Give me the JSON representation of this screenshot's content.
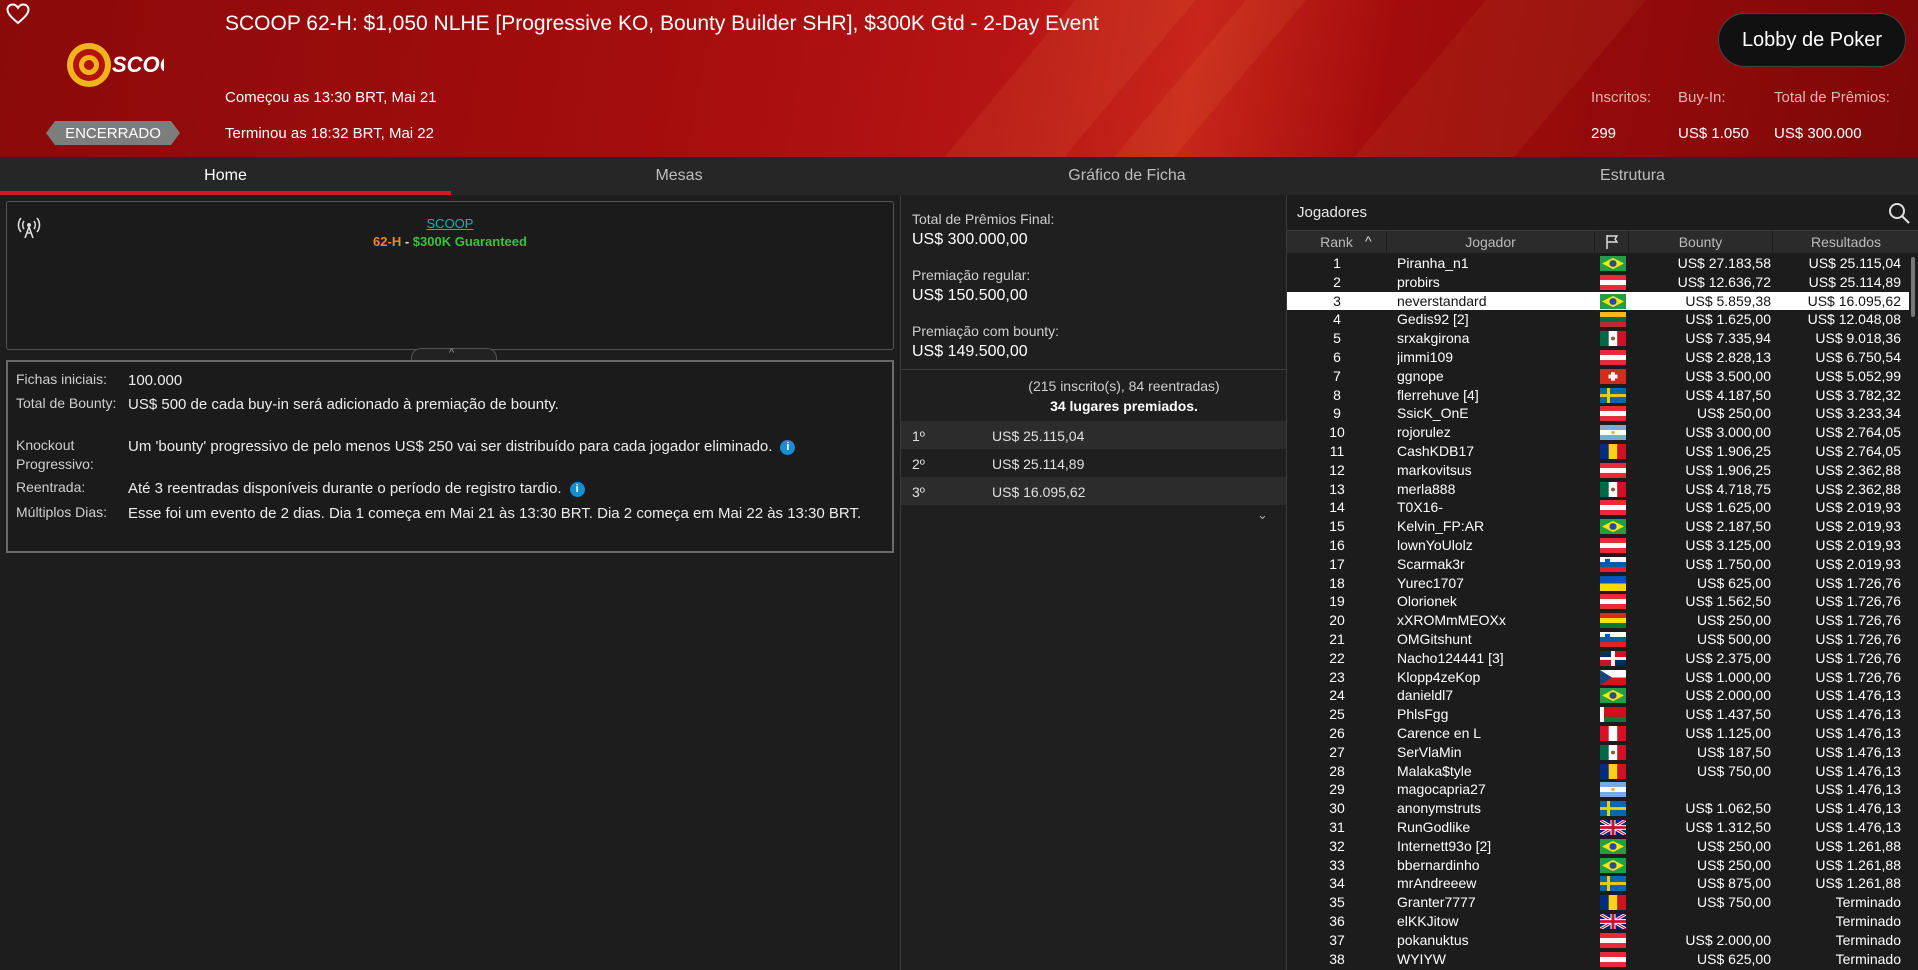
{
  "header": {
    "title": "SCOOP 62-H: $1,050 NLHE [Progressive KO, Bounty Builder SHR], $300K Gtd - 2-Day Event",
    "status_badge": "ENCERRADO",
    "started": "Começou as 13:30 BRT, Mai 21",
    "ended": "Terminou as 18:32 BRT, Mai 22",
    "lobby_button": "Lobby de Poker",
    "logo_text": "SCOOP",
    "stats": {
      "entrants_label": "Inscritos:",
      "entrants_value": "299",
      "buyin_label": "Buy-In:",
      "buyin_value": "US$ 1.050",
      "prize_label": "Total de Prêmios:",
      "prize_value": "US$ 300.000"
    }
  },
  "tabs": [
    {
      "label": "Home",
      "active": true
    },
    {
      "label": "Mesas"
    },
    {
      "label": "Gráfico de Ficha"
    },
    {
      "label": "Estrutura"
    }
  ],
  "info": {
    "link": "SCOOP",
    "sub_event": "62-H",
    "sub_sep": " - ",
    "sub_guarantee": "$300K Guaranteed"
  },
  "details": [
    {
      "label": "Fichas iniciais:",
      "value": "100.000"
    },
    {
      "label": "Total de Bounty:",
      "value": "US$ 500 de cada buy-in será adicionado à premiação de bounty."
    },
    {
      "label": "Knockout Progressivo:",
      "value": "Um 'bounty' progressivo de pelo menos US$ 250 vai ser distribuído para cada jogador eliminado."
    },
    {
      "label": "Reentrada:",
      "value": "Até 3 reentradas disponíveis durante o período de registro tardio."
    },
    {
      "label": "Múltiplos Dias:",
      "value": "Esse foi um evento de 2 dias. Dia 1 começa em Mai 21 às 13:30 BRT. Dia 2 começa em Mai 22 às 13:30 BRT."
    }
  ],
  "prizes": {
    "final_label": "Total de Prêmios Final:",
    "final_value": "US$ 300.000,00",
    "regular_label": "Premiação regular:",
    "regular_value": "US$ 150.500,00",
    "bounty_label": "Premiação com bounty:",
    "bounty_value": "US$ 149.500,00",
    "entries_text": "(215 inscrito(s), 84 reentradas)",
    "places_text": "34 lugares premiados.",
    "places": [
      {
        "place": "1º",
        "amount": "US$ 25.115,04"
      },
      {
        "place": "2º",
        "amount": "US$ 25.114,89"
      },
      {
        "place": "3º",
        "amount": "US$ 16.095,62"
      }
    ]
  },
  "players": {
    "title": "Jogadores",
    "columns": {
      "rank": "Rank",
      "player": "Jogador",
      "bounty": "Bounty",
      "results": "Resultados"
    },
    "highlight_rank": "3",
    "rows": [
      {
        "rank": "1",
        "name": "Piranha_n1",
        "flag": "br",
        "bounty": "US$ 27.183,58",
        "result": "US$ 25.115,04"
      },
      {
        "rank": "2",
        "name": "probirs",
        "flag": "at",
        "bounty": "US$ 12.636,72",
        "result": "US$ 25.114,89"
      },
      {
        "rank": "3",
        "name": "neverstandard",
        "flag": "br",
        "bounty": "US$ 5.859,38",
        "result": "US$ 16.095,62"
      },
      {
        "rank": "4",
        "name": "Gedis92 [2]",
        "flag": "lt",
        "bounty": "US$ 1.625,00",
        "result": "US$ 12.048,08"
      },
      {
        "rank": "5",
        "name": "srxakgirona",
        "flag": "mx",
        "bounty": "US$ 7.335,94",
        "result": "US$ 9.018,36"
      },
      {
        "rank": "6",
        "name": "jimmi109",
        "flag": "at",
        "bounty": "US$ 2.828,13",
        "result": "US$ 6.750,54"
      },
      {
        "rank": "7",
        "name": "ggnope",
        "flag": "ch",
        "bounty": "US$ 3.500,00",
        "result": "US$ 5.052,99"
      },
      {
        "rank": "8",
        "name": "flerrehuve [4]",
        "flag": "se",
        "bounty": "US$ 4.187,50",
        "result": "US$ 3.782,32"
      },
      {
        "rank": "9",
        "name": "SsicK_OnE",
        "flag": "at",
        "bounty": "US$ 250,00",
        "result": "US$ 3.233,34"
      },
      {
        "rank": "10",
        "name": "rojorulez",
        "flag": "ar",
        "bounty": "US$ 3.000,00",
        "result": "US$ 2.764,05"
      },
      {
        "rank": "11",
        "name": "CashKDB17",
        "flag": "ro",
        "bounty": "US$ 1.906,25",
        "result": "US$ 2.764,05"
      },
      {
        "rank": "12",
        "name": "markovitsus",
        "flag": "at",
        "bounty": "US$ 1.906,25",
        "result": "US$ 2.362,88"
      },
      {
        "rank": "13",
        "name": "merla888",
        "flag": "mx",
        "bounty": "US$ 4.718,75",
        "result": "US$ 2.362,88"
      },
      {
        "rank": "14",
        "name": "T0X16-",
        "flag": "at",
        "bounty": "US$ 1.625,00",
        "result": "US$ 2.019,93"
      },
      {
        "rank": "15",
        "name": "Kelvin_FP:AR",
        "flag": "br",
        "bounty": "US$ 2.187,50",
        "result": "US$ 2.019,93"
      },
      {
        "rank": "16",
        "name": "lownYoUlolz",
        "flag": "at",
        "bounty": "US$ 3.125,00",
        "result": "US$ 2.019,93"
      },
      {
        "rank": "17",
        "name": "Scarmak3r",
        "flag": "si",
        "bounty": "US$ 1.750,00",
        "result": "US$ 2.019,93"
      },
      {
        "rank": "18",
        "name": "Yurec1707",
        "flag": "ua",
        "bounty": "US$ 625,00",
        "result": "US$ 1.726,76"
      },
      {
        "rank": "19",
        "name": "Olorionek",
        "flag": "at",
        "bounty": "US$ 1.562,50",
        "result": "US$ 1.726,76"
      },
      {
        "rank": "20",
        "name": "xXROMmMEOXx",
        "flag": "bo",
        "bounty": "US$ 250,00",
        "result": "US$ 1.726,76"
      },
      {
        "rank": "21",
        "name": "OMGitshunt",
        "flag": "si",
        "bounty": "US$ 500,00",
        "result": "US$ 1.726,76"
      },
      {
        "rank": "22",
        "name": "Nacho124441 [3]",
        "flag": "do",
        "bounty": "US$ 2.375,00",
        "result": "US$ 1.726,76"
      },
      {
        "rank": "23",
        "name": "Klopp4zeKop",
        "flag": "cz",
        "bounty": "US$ 1.000,00",
        "result": "US$ 1.726,76"
      },
      {
        "rank": "24",
        "name": "danieldl7",
        "flag": "br",
        "bounty": "US$ 2.000,00",
        "result": "US$ 1.476,13"
      },
      {
        "rank": "25",
        "name": "PhlsFgg",
        "flag": "by",
        "bounty": "US$ 1.437,50",
        "result": "US$ 1.476,13"
      },
      {
        "rank": "26",
        "name": "Carence en L",
        "flag": "pe",
        "bounty": "US$ 1.125,00",
        "result": "US$ 1.476,13"
      },
      {
        "rank": "27",
        "name": "SerVlaMin",
        "flag": "mx",
        "bounty": "US$ 187,50",
        "result": "US$ 1.476,13"
      },
      {
        "rank": "28",
        "name": "Malaka$tyle",
        "flag": "ro",
        "bounty": "US$ 750,00",
        "result": "US$ 1.476,13"
      },
      {
        "rank": "29",
        "name": "magocapria27",
        "flag": "ar",
        "bounty": "",
        "result": "US$ 1.476,13"
      },
      {
        "rank": "30",
        "name": "anonymstruts",
        "flag": "se",
        "bounty": "US$ 1.062,50",
        "result": "US$ 1.476,13"
      },
      {
        "rank": "31",
        "name": "RunGodlike",
        "flag": "gb",
        "bounty": "US$ 1.312,50",
        "result": "US$ 1.476,13"
      },
      {
        "rank": "32",
        "name": "Internett93o [2]",
        "flag": "br",
        "bounty": "US$ 250,00",
        "result": "US$ 1.261,88"
      },
      {
        "rank": "33",
        "name": "bbernardinho",
        "flag": "br",
        "bounty": "US$ 250,00",
        "result": "US$ 1.261,88"
      },
      {
        "rank": "34",
        "name": "mrAndreeew",
        "flag": "se",
        "bounty": "US$ 875,00",
        "result": "US$ 1.261,88"
      },
      {
        "rank": "35",
        "name": "Granter7777",
        "flag": "ro",
        "bounty": "US$ 750,00",
        "result": "Terminado"
      },
      {
        "rank": "36",
        "name": "elKKJitow",
        "flag": "gb",
        "bounty": "",
        "result": "Terminado"
      },
      {
        "rank": "37",
        "name": "pokanuktus",
        "flag": "at",
        "bounty": "US$ 2.000,00",
        "result": "Terminado"
      },
      {
        "rank": "38",
        "name": "WYIYW",
        "flag": "at",
        "bounty": "US$ 625,00",
        "result": "Terminado"
      }
    ]
  },
  "colors": {
    "accent_red": "#d21a1a",
    "sub_event_orange": "#e88a2a",
    "guarantee_green": "#3fbf3f",
    "link_teal": "#19b3b3",
    "info_blue": "#168fd0"
  }
}
